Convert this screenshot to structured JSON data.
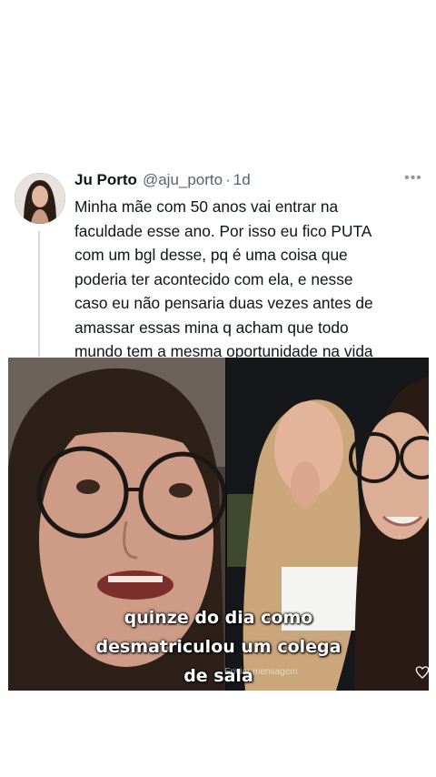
{
  "tweet": {
    "author_name": "Ju Porto",
    "handle": "@aju_porto",
    "separator": "·",
    "time": "1d",
    "more_label": "•••",
    "text": "Minha mãe com 50 anos vai entrar na\nfaculdade esse ano. Por isso eu fico PUTA\ncom um bgl desse, pq é uma coisa que\npoderia ter acontecido com ela, e nesse\ncaso eu não pensaria duas vezes antes de\namassar essas mina q acham que todo\nmundo tem a mesma oportunidade na vida"
  },
  "media": {
    "caption": "quinze do dia como\ndesmatriculou um colega\nde sala",
    "watermark": "Enviar mensagem"
  },
  "colors": {
    "text": "#0f1419",
    "secondary": "#536471",
    "thread_line": "#cfd9de"
  },
  "icons": [
    "avatar",
    "more-options-icon",
    "heart-icon"
  ]
}
